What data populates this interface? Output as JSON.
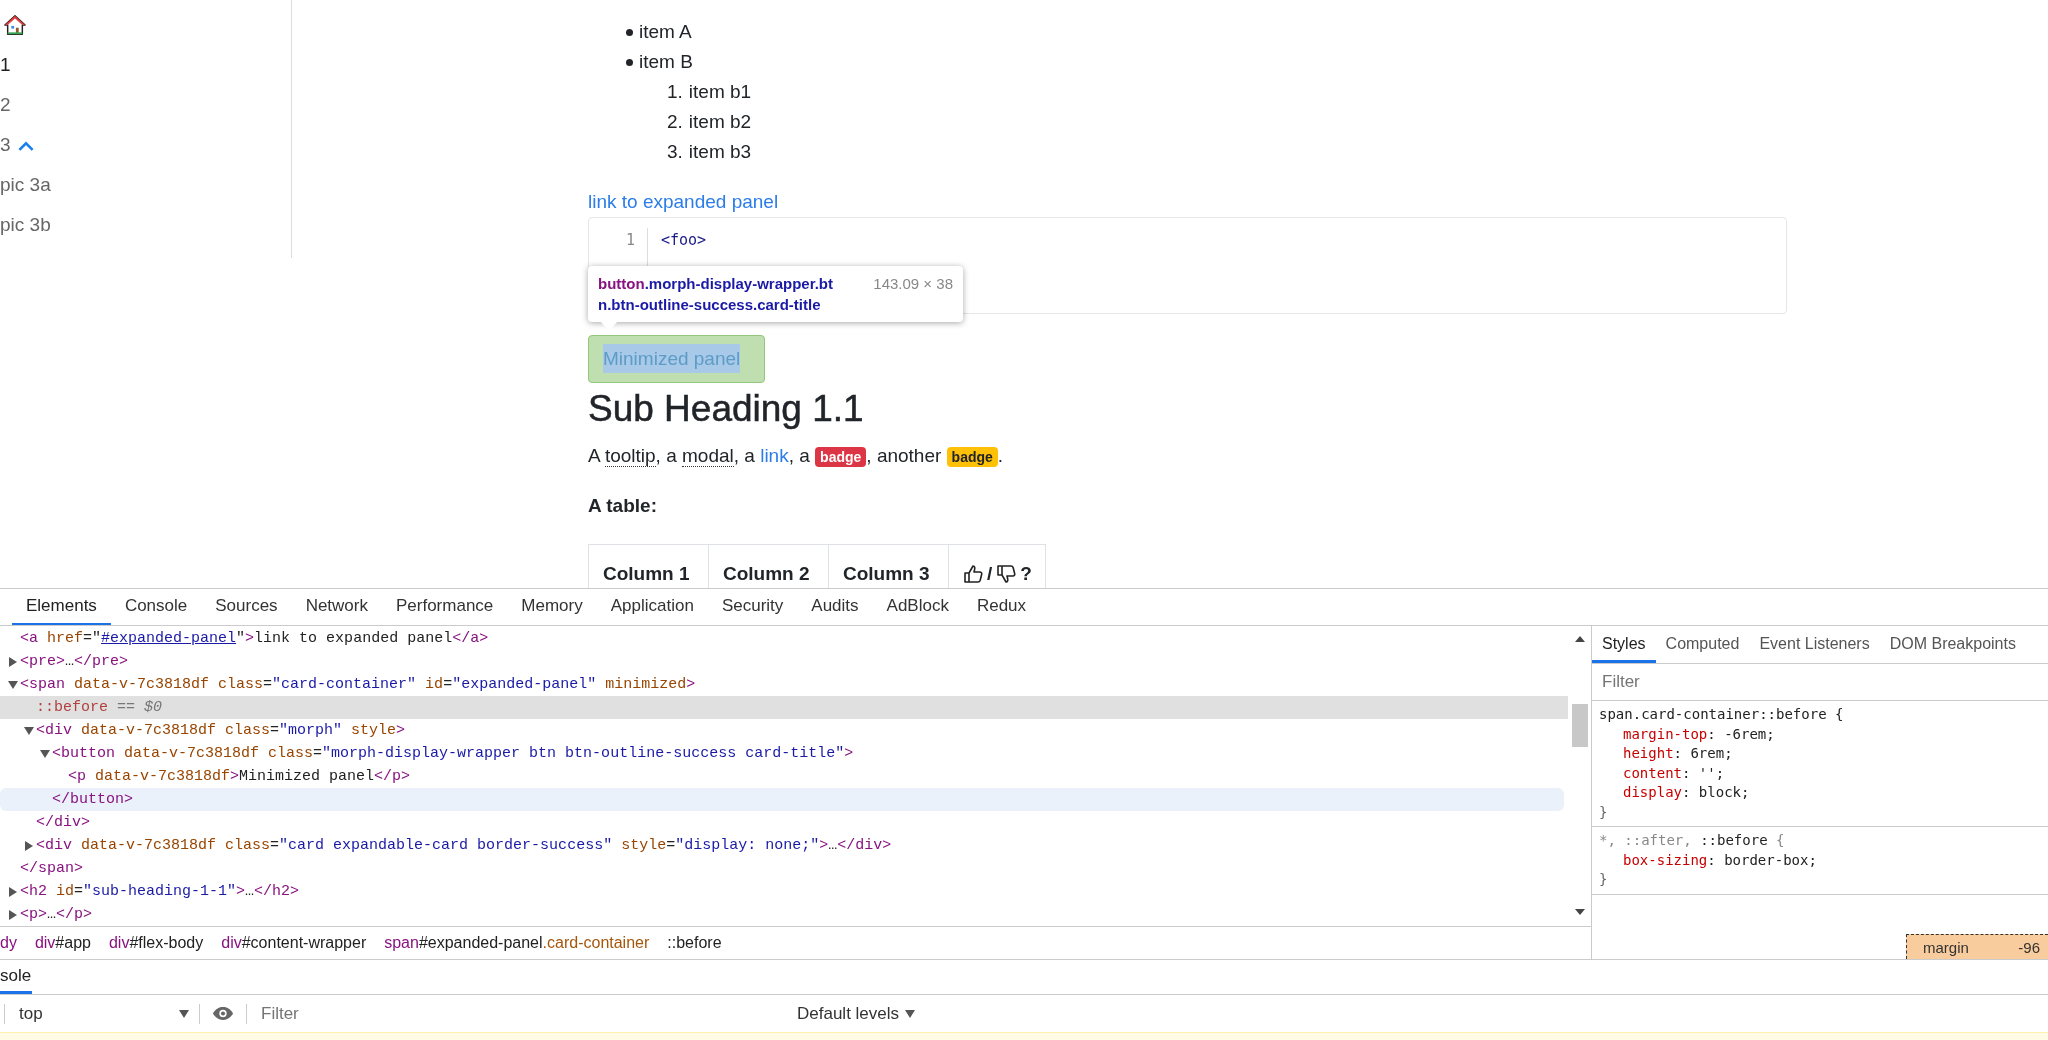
{
  "sidebar": {
    "items": [
      {
        "kind": "home"
      },
      {
        "kind": "link",
        "label": "1",
        "selected": true
      },
      {
        "kind": "link",
        "label": "2",
        "selected": false
      },
      {
        "kind": "link",
        "label": "3",
        "selected": false,
        "expanded": true,
        "children": [
          {
            "kind": "link",
            "label": "pic 3a",
            "selected": false
          },
          {
            "kind": "link",
            "label": "pic 3b",
            "selected": false
          }
        ]
      }
    ]
  },
  "content": {
    "bullets": [
      {
        "text": "item A"
      },
      {
        "text": "item B",
        "children": [
          {
            "marker": "1.",
            "text": "item b1"
          },
          {
            "marker": "2.",
            "text": "item b2"
          },
          {
            "marker": "3.",
            "text": "item b3"
          }
        ]
      }
    ],
    "link": "link to expanded panel",
    "code": [
      {
        "number": "1",
        "segments": [
          {
            "kind": "tag",
            "text": "<foo>"
          }
        ]
      }
    ],
    "tooltip": {
      "lines": [
        [
          {
            "kind": "tag",
            "text": "button"
          },
          {
            "kind": "class",
            "text": ".morph-display-wrapper.bt"
          }
        ],
        [
          {
            "kind": "class",
            "text": "n.btn-outline-success.card-title"
          }
        ]
      ],
      "size": "143.09 × 38"
    },
    "panel_button": "Minimized panel",
    "heading": "Sub Heading 1.1",
    "paragraph": [
      {
        "kind": "text",
        "text": "A "
      },
      {
        "kind": "abbr",
        "text": "tooltip"
      },
      {
        "kind": "text",
        "text": ", a "
      },
      {
        "kind": "abbr",
        "text": "modal"
      },
      {
        "kind": "text",
        "text": ", a "
      },
      {
        "kind": "link",
        "text": "link"
      },
      {
        "kind": "text",
        "text": ", a "
      },
      {
        "kind": "badge",
        "text": "badge",
        "color": "#dc3545"
      },
      {
        "kind": "text",
        "text": ", another "
      },
      {
        "kind": "badge",
        "text": "badge",
        "color": "#ffc107"
      },
      {
        "kind": "text",
        "text": "."
      }
    ],
    "table_caption": "A table:",
    "table": {
      "columns": [
        {
          "kind": "text",
          "label": "Column 1"
        },
        {
          "kind": "text",
          "label": "Column 2"
        },
        {
          "kind": "text",
          "label": "Column 3"
        },
        {
          "kind": "vote",
          "separator": "/",
          "suffix": "?"
        }
      ]
    }
  },
  "devtools": {
    "tabs": [
      {
        "label": "Elements",
        "selected": true
      },
      {
        "label": "Console",
        "selected": false
      },
      {
        "label": "Sources",
        "selected": false
      },
      {
        "label": "Network",
        "selected": false
      },
      {
        "label": "Performance",
        "selected": false
      },
      {
        "label": "Memory",
        "selected": false
      },
      {
        "label": "Application",
        "selected": false
      },
      {
        "label": "Security",
        "selected": false
      },
      {
        "label": "Audits",
        "selected": false
      },
      {
        "label": "AdBlock",
        "selected": false
      },
      {
        "label": "Redux",
        "selected": false
      }
    ],
    "nodes": [
      {
        "kind": "plain",
        "selected": false,
        "hovered": false,
        "segments": [
          {
            "kind": "tag",
            "text": "<a "
          },
          {
            "kind": "attr",
            "text": "href"
          },
          {
            "kind": "text",
            "text": "=\""
          },
          {
            "kind": "link",
            "text": "#expanded-panel"
          },
          {
            "kind": "text",
            "text": "\""
          },
          {
            "kind": "tag",
            "text": ">"
          },
          {
            "kind": "text",
            "text": "link to expanded panel"
          },
          {
            "kind": "tag",
            "text": "</a>"
          }
        ]
      },
      {
        "kind": "expandable",
        "expanded": false,
        "selected": false,
        "hovered": false,
        "segments": [
          {
            "kind": "tag",
            "text": "<pre>"
          },
          {
            "kind": "text",
            "text": "…"
          },
          {
            "kind": "tag",
            "text": "</pre>"
          }
        ]
      },
      {
        "kind": "expandable",
        "expanded": true,
        "selected": false,
        "hovered": false,
        "segments": [
          {
            "kind": "tag",
            "text": "<span "
          },
          {
            "kind": "attr",
            "text": "data-v-7c3818df "
          },
          {
            "kind": "attr",
            "text": "class"
          },
          {
            "kind": "text",
            "text": "="
          },
          {
            "kind": "value",
            "text": "\"card-container\""
          },
          {
            "kind": "attr",
            "text": " id"
          },
          {
            "kind": "text",
            "text": "="
          },
          {
            "kind": "value",
            "text": "\"expanded-panel\""
          },
          {
            "kind": "attr",
            "text": " minimized"
          },
          {
            "kind": "tag",
            "text": ">"
          }
        ],
        "close": {
          "hovered": false,
          "segments": [
            {
              "kind": "tag",
              "text": "</span>"
            }
          ]
        },
        "children": [
          {
            "kind": "plain",
            "selected": true,
            "hovered": false,
            "segments": [
              {
                "kind": "pseudo",
                "text": "::before"
              },
              {
                "kind": "hint",
                "text": " == $0"
              }
            ]
          },
          {
            "kind": "expandable",
            "expanded": true,
            "selected": false,
            "hovered": false,
            "segments": [
              {
                "kind": "tag",
                "text": "<div "
              },
              {
                "kind": "attr",
                "text": "data-v-7c3818df "
              },
              {
                "kind": "attr",
                "text": "class"
              },
              {
                "kind": "text",
                "text": "="
              },
              {
                "kind": "value",
                "text": "\"morph\""
              },
              {
                "kind": "attr",
                "text": " style"
              },
              {
                "kind": "tag",
                "text": ">"
              }
            ],
            "close": {
              "hovered": false,
              "segments": [
                {
                  "kind": "tag",
                  "text": "</div>"
                }
              ]
            },
            "children": [
              {
                "kind": "expandable",
                "expanded": true,
                "selected": false,
                "hovered": false,
                "segments": [
                  {
                    "kind": "tag",
                    "text": "<button "
                  },
                  {
                    "kind": "attr",
                    "text": "data-v-7c3818df "
                  },
                  {
                    "kind": "attr",
                    "text": "class"
                  },
                  {
                    "kind": "text",
                    "text": "="
                  },
                  {
                    "kind": "value",
                    "text": "\"morph-display-wrapper btn btn-outline-success card-title\""
                  },
                  {
                    "kind": "tag",
                    "text": ">"
                  }
                ],
                "close": {
                  "hovered": true,
                  "segments": [
                    {
                      "kind": "tag",
                      "text": "</button>"
                    }
                  ]
                },
                "children": [
                  {
                    "kind": "plain",
                    "selected": false,
                    "hovered": false,
                    "segments": [
                      {
                        "kind": "tag",
                        "text": "<p "
                      },
                      {
                        "kind": "attr",
                        "text": "data-v-7c3818df"
                      },
                      {
                        "kind": "tag",
                        "text": ">"
                      },
                      {
                        "kind": "text",
                        "text": "Minimized panel"
                      },
                      {
                        "kind": "tag",
                        "text": "</p>"
                      }
                    ]
                  }
                ]
              }
            ]
          },
          {
            "kind": "expandable",
            "expanded": false,
            "selected": false,
            "hovered": false,
            "segments": [
              {
                "kind": "tag",
                "text": "<div "
              },
              {
                "kind": "attr",
                "text": "data-v-7c3818df "
              },
              {
                "kind": "attr",
                "text": "class"
              },
              {
                "kind": "text",
                "text": "="
              },
              {
                "kind": "value",
                "text": "\"card expandable-card border-success\""
              },
              {
                "kind": "attr",
                "text": " style"
              },
              {
                "kind": "text",
                "text": "="
              },
              {
                "kind": "value",
                "text": "\"display: none;\""
              },
              {
                "kind": "tag",
                "text": ">"
              },
              {
                "kind": "text",
                "text": "…"
              },
              {
                "kind": "tag",
                "text": "</div>"
              }
            ]
          }
        ]
      },
      {
        "kind": "expandable",
        "expanded": false,
        "selected": false,
        "hovered": false,
        "segments": [
          {
            "kind": "tag",
            "text": "<h2 "
          },
          {
            "kind": "attr",
            "text": "id"
          },
          {
            "kind": "text",
            "text": "="
          },
          {
            "kind": "value",
            "text": "\"sub-heading-1-1\""
          },
          {
            "kind": "tag",
            "text": ">"
          },
          {
            "kind": "text",
            "text": "…"
          },
          {
            "kind": "tag",
            "text": "</h2>"
          }
        ]
      },
      {
        "kind": "expandable",
        "expanded": false,
        "selected": false,
        "hovered": false,
        "segments": [
          {
            "kind": "tag",
            "text": "<p>"
          },
          {
            "kind": "text",
            "text": "…"
          },
          {
            "kind": "tag",
            "text": "</p>"
          }
        ]
      }
    ],
    "breadcrumbs": [
      [
        {
          "kind": "tag",
          "text": "dy"
        }
      ],
      [
        {
          "kind": "tag",
          "text": "div"
        },
        {
          "kind": "id",
          "text": "#app"
        }
      ],
      [
        {
          "kind": "tag",
          "text": "div"
        },
        {
          "kind": "id",
          "text": "#flex-body"
        }
      ],
      [
        {
          "kind": "tag",
          "text": "div"
        },
        {
          "kind": "id",
          "text": "#content-wrapper"
        }
      ],
      [
        {
          "kind": "tag",
          "text": "span"
        },
        {
          "kind": "id",
          "text": "#expanded-panel"
        },
        {
          "kind": "class",
          "text": ".card-container"
        }
      ],
      [
        {
          "kind": "id",
          "text": "::before"
        }
      ]
    ],
    "side_tabs": [
      {
        "label": "Styles",
        "selected": true
      },
      {
        "label": "Computed",
        "selected": false
      },
      {
        "label": "Event Listeners",
        "selected": false
      },
      {
        "label": "DOM Breakpoints",
        "selected": false
      }
    ],
    "styles_filter": {
      "placeholder": "Filter"
    },
    "rules": [
      {
        "selector": [
          {
            "kind": "match",
            "text": "span.card-container::before"
          },
          {
            "kind": "match",
            "text": " {"
          }
        ],
        "declarations": [
          {
            "property": "margin-top",
            "value": ": -6rem;"
          },
          {
            "property": "height",
            "value": ": 6rem;"
          },
          {
            "property": "content",
            "value": ": '';"
          },
          {
            "property": "display",
            "value": ": block;"
          }
        ],
        "close": "}"
      },
      {
        "selector": [
          {
            "kind": "nomatch",
            "text": "*, ::after, "
          },
          {
            "kind": "match",
            "text": "::before"
          },
          {
            "kind": "nomatch",
            "text": " {"
          }
        ],
        "declarations": [
          {
            "property": "box-sizing",
            "value": ": border-box;"
          }
        ],
        "close": "}"
      }
    ],
    "box_model": {
      "label": "margin",
      "value": "-96"
    },
    "drawer_tabs": [
      {
        "label": "sole",
        "selected": true
      }
    ],
    "console": {
      "context": "top",
      "filter_placeholder": "Filter",
      "levels": "Default levels"
    }
  }
}
